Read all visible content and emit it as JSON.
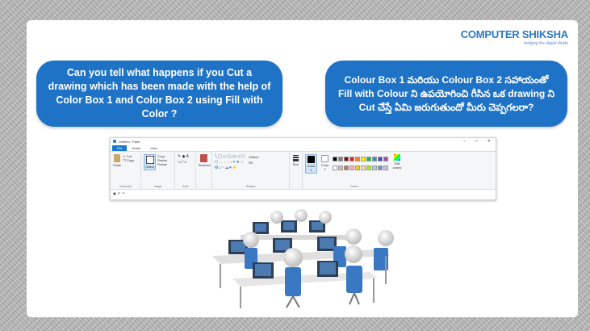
{
  "logo": {
    "name_part1": "COMPUTER ",
    "name_part2": "SHIKSHA",
    "tagline": "bridging the digital divide"
  },
  "question_english": "Can you tell what happens if you Cut a drawing which has been made with the help of Color Box 1 and Color Box 2 using Fill with Color ?",
  "question_telugu": "Colour Box 1 మరియు Colour Box 2 సహాయంతో Fill with Colour ని ఉపయోగించి గీసిన ఒక drawing ని Cut చేస్తే ఏమి జరుగుతుందో మీరు చెప్పగలరా?",
  "paint_window": {
    "title": "Untitled - Paint",
    "tabs": [
      "File",
      "Home",
      "View"
    ],
    "window_controls": [
      "–",
      "□",
      "✕"
    ],
    "groups": {
      "clipboard": "Clipboard",
      "image": "Image",
      "tools": "Tools",
      "shapes": "Shapes",
      "colors": "Colors"
    },
    "buttons": {
      "paste": "Paste",
      "cut": "Cut",
      "copy": "Copy",
      "select": "Select",
      "crop": "Crop",
      "resize": "Resize",
      "rotate": "Rotate",
      "brushes": "Brushes",
      "outline": "Outline",
      "fill": "Fill",
      "size": "Size",
      "color1": "Color 1",
      "color2": "Color 2",
      "edit_colors": "Edit colors"
    },
    "palette": [
      "#000000",
      "#7f7f7f",
      "#880015",
      "#ed1c24",
      "#ff7f27",
      "#fff200",
      "#22b14c",
      "#00a2e8",
      "#3f48cc",
      "#a349a4",
      "#ffffff",
      "#c3c3c3",
      "#b97a57",
      "#ffaec9",
      "#ffc90e",
      "#efe4b0",
      "#b5e61d",
      "#99d9ea",
      "#7092be",
      "#c8bfe7"
    ]
  }
}
